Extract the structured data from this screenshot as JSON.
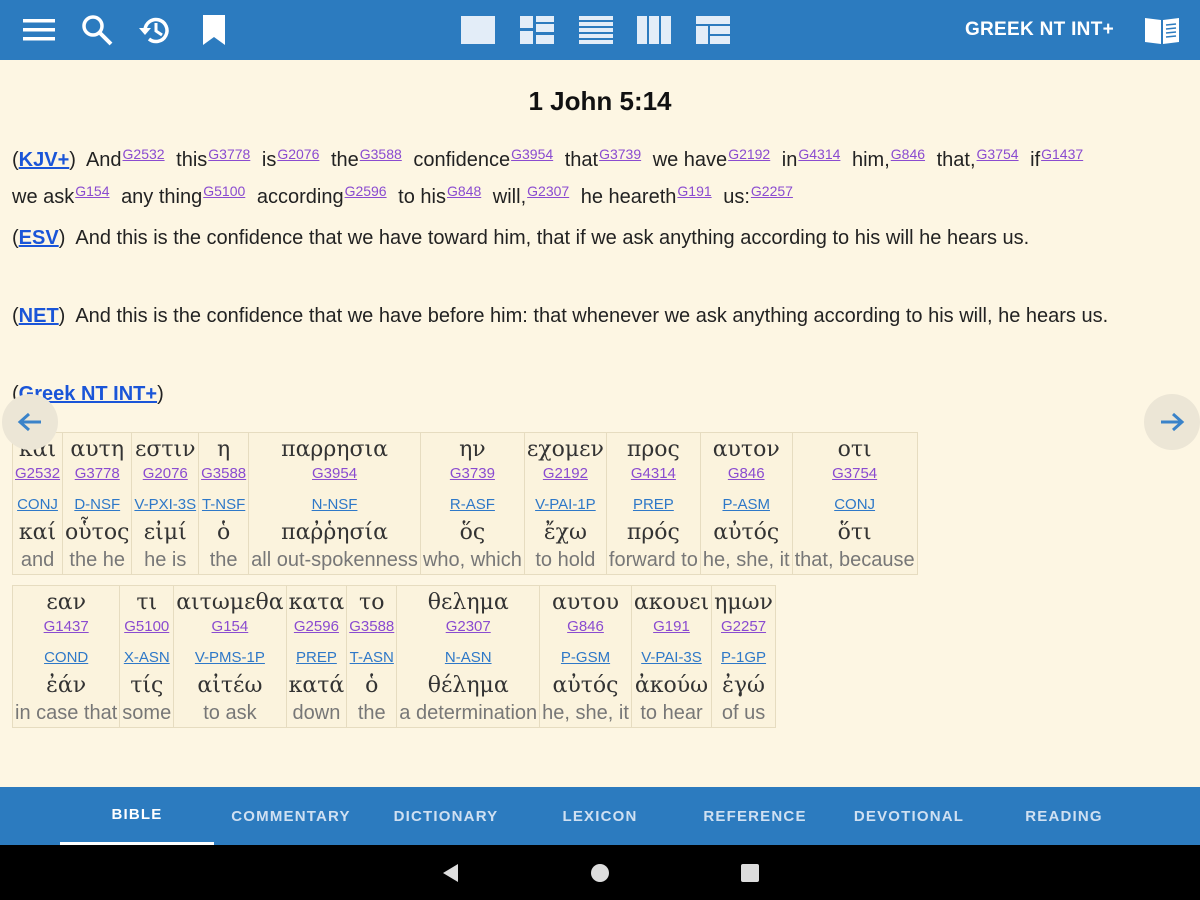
{
  "app": {
    "module_title": "GREEK NT INT+",
    "icons": [
      "menu-icon",
      "search-icon",
      "history-icon",
      "bookmark-icon",
      "single-pane-icon",
      "parallel-pane-icon",
      "list-pane-icon",
      "column-pane-icon",
      "grid-pane-icon",
      "book-icon"
    ]
  },
  "reference": "1 John 5:14",
  "kjv": {
    "tag": "KJV+",
    "words": [
      {
        "t": "And",
        "s": "G2532"
      },
      {
        "t": "this",
        "s": "G3778"
      },
      {
        "t": "is",
        "s": "G2076"
      },
      {
        "t": "the",
        "s": "G3588"
      },
      {
        "t": "confidence",
        "s": "G3954"
      },
      {
        "t": "that",
        "s": "G3739"
      },
      {
        "t": "we have",
        "s": "G2192"
      },
      {
        "t": "in",
        "s": "G4314"
      },
      {
        "t": "him,",
        "s": "G846"
      },
      {
        "t": "that,",
        "s": "G3754"
      },
      {
        "t": "if",
        "s": "G1437"
      },
      {
        "t": "we ask",
        "s": "G154"
      },
      {
        "t": "any thing",
        "s": "G5100"
      },
      {
        "t": "according",
        "s": "G2596"
      },
      {
        "t": "to his",
        "s": "G848"
      },
      {
        "t": "will,",
        "s": "G2307"
      },
      {
        "t": "he heareth",
        "s": "G191"
      },
      {
        "t": "us:",
        "s": "G2257"
      }
    ]
  },
  "esv": {
    "tag": "ESV",
    "text": "And this is the confidence that we have toward him, that if we ask anything according to his will he hears us."
  },
  "net": {
    "tag": "NET",
    "text": "And this is the confidence that we have before him: that whenever we ask anything according to his will, he hears us."
  },
  "greek": {
    "tag": "Greek NT INT+",
    "row1": [
      {
        "g": "και",
        "s": "G2532",
        "m": "CONJ",
        "l": "καί",
        "e": "and"
      },
      {
        "g": "αυτη",
        "s": "G3778",
        "m": "D-NSF",
        "l": "οὗτος",
        "e": "the he"
      },
      {
        "g": "εστιν",
        "s": "G2076",
        "m": "V-PXI-3S",
        "l": "εἰμί",
        "e": "he is"
      },
      {
        "g": "η",
        "s": "G3588",
        "m": "T-NSF",
        "l": "ὁ",
        "e": "the"
      },
      {
        "g": "παρρησια",
        "s": "G3954",
        "m": "N-NSF",
        "l": "παῤῥησία",
        "e": "all out-spokenness"
      },
      {
        "g": "ην",
        "s": "G3739",
        "m": "R-ASF",
        "l": "ὅς",
        "e": "who, which"
      },
      {
        "g": "εχομεν",
        "s": "G2192",
        "m": "V-PAI-1P",
        "l": "ἔχω",
        "e": "to hold"
      },
      {
        "g": "προς",
        "s": "G4314",
        "m": "PREP",
        "l": "πρός",
        "e": "forward to"
      },
      {
        "g": "αυτον",
        "s": "G846",
        "m": "P-ASM",
        "l": "αὐτός",
        "e": "he, she, it"
      },
      {
        "g": "οτι",
        "s": "G3754",
        "m": "CONJ",
        "l": "ὅτι",
        "e": "that, because"
      }
    ],
    "row2": [
      {
        "g": "εαν",
        "s": "G1437",
        "m": "COND",
        "l": "ἐάν",
        "e": "in case that"
      },
      {
        "g": "τι",
        "s": "G5100",
        "m": "X-ASN",
        "l": "τίς",
        "e": "some"
      },
      {
        "g": "αιτωμεθα",
        "s": "G154",
        "m": "V-PMS-1P",
        "l": "αἰτέω",
        "e": "to ask"
      },
      {
        "g": "κατα",
        "s": "G2596",
        "m": "PREP",
        "l": "κατά",
        "e": "down"
      },
      {
        "g": "το",
        "s": "G3588",
        "m": "T-ASN",
        "l": "ὁ",
        "e": "the"
      },
      {
        "g": "θελημα",
        "s": "G2307",
        "m": "N-ASN",
        "l": "θέλημα",
        "e": "a determination"
      },
      {
        "g": "αυτου",
        "s": "G846",
        "m": "P-GSM",
        "l": "αὐτός",
        "e": "he, she, it"
      },
      {
        "g": "ακουει",
        "s": "G191",
        "m": "V-PAI-3S",
        "l": "ἀκούω",
        "e": "to hear"
      },
      {
        "g": "ημων",
        "s": "G2257",
        "m": "P-1GP",
        "l": "ἐγώ",
        "e": "of us"
      }
    ]
  },
  "tabs": [
    "BIBLE",
    "COMMENTARY",
    "DICTIONARY",
    "LEXICON",
    "REFERENCE",
    "DEVOTIONAL",
    "READING"
  ],
  "active_tab": "BIBLE",
  "colors": {
    "accent": "#2c7bbf",
    "background": "#fdf6e3",
    "strong": "#8a4bd0",
    "morph": "#2e78c8",
    "link": "#1a55d8"
  }
}
